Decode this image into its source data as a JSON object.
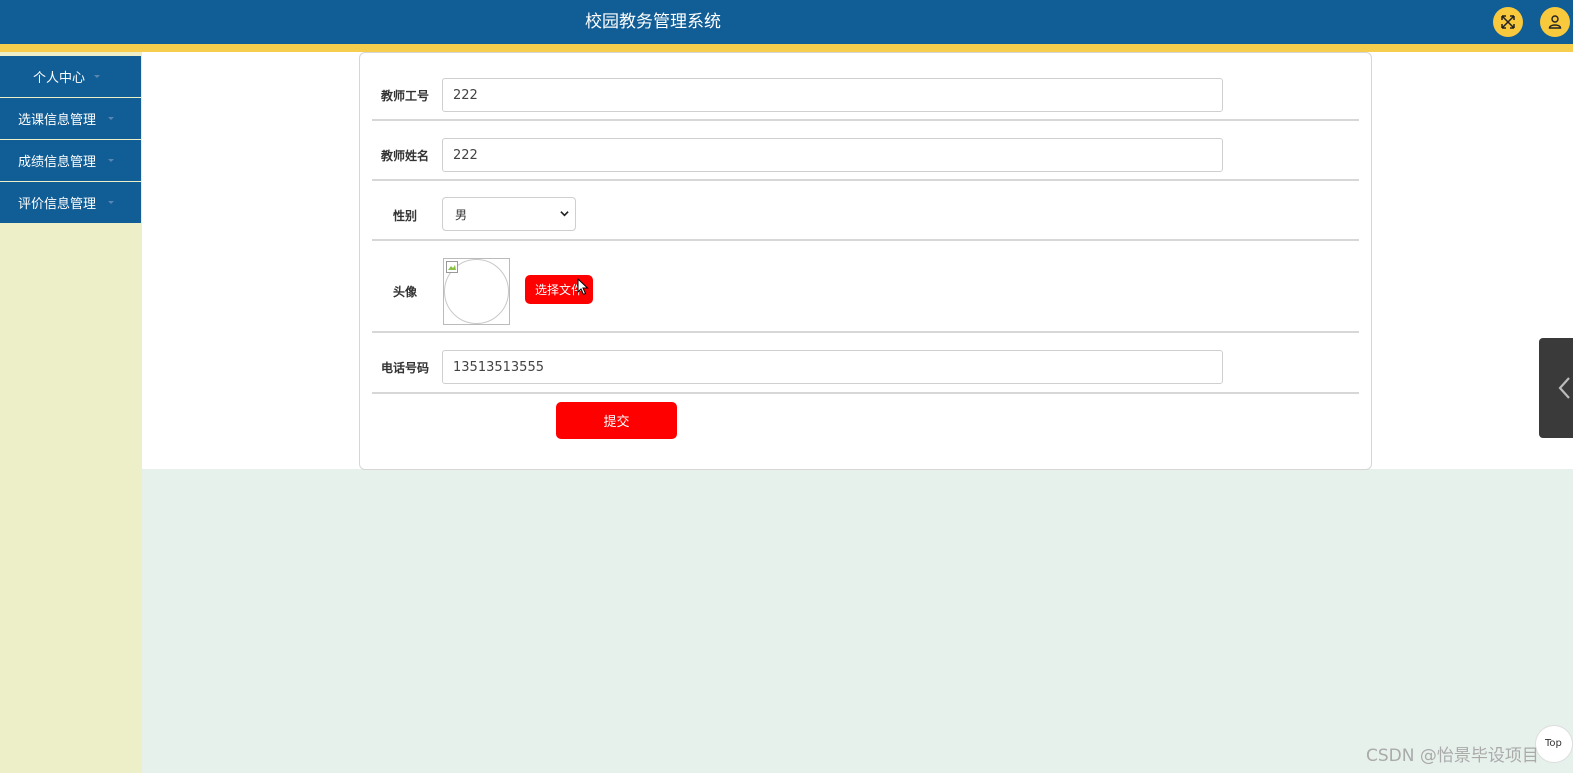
{
  "header": {
    "title": "校园教务管理系统",
    "fullscreen_icon": "fullscreen-toggle-icon",
    "user_icon": "user-icon",
    "color": "#115d96",
    "stripe_color": "#f6cd4c",
    "button_color": "#f8c93c"
  },
  "sidebar": {
    "items": [
      {
        "label": "个人中心"
      },
      {
        "label": "选课信息管理"
      },
      {
        "label": "成绩信息管理"
      },
      {
        "label": "评价信息管理"
      }
    ],
    "background": "#ecefc8"
  },
  "form": {
    "teacher_id": {
      "label": "教师工号",
      "value": "222"
    },
    "teacher_name": {
      "label": "教师姓名",
      "value": "222"
    },
    "gender": {
      "label": "性别",
      "value": "男"
    },
    "avatar": {
      "label": "头像",
      "button_label": "选择文件"
    },
    "phone": {
      "label": "电话号码",
      "value": "13513513555"
    },
    "submit_label": "提交",
    "button_color": "#ff0000"
  },
  "floating": {
    "top_label": "Top",
    "side_tab_icon": "chevron-left-icon"
  },
  "watermark": "CSDN @怡景毕设项目"
}
